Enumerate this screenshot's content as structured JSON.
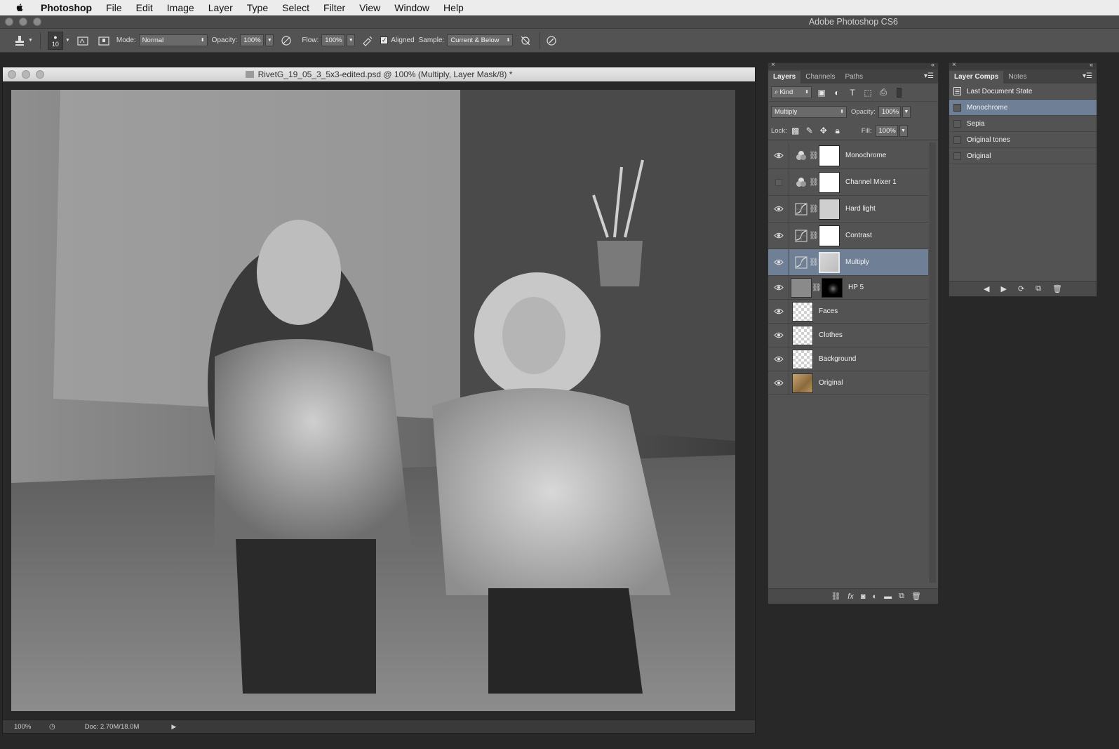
{
  "menubar": {
    "app_name": "Photoshop",
    "items": [
      "File",
      "Edit",
      "Image",
      "Layer",
      "Type",
      "Select",
      "Filter",
      "View",
      "Window",
      "Help"
    ]
  },
  "app_title": "Adobe Photoshop CS6",
  "options_bar": {
    "tool_icon": "clone-stamp-icon",
    "brush_size": "10",
    "mode_label": "Mode:",
    "mode_value": "Normal",
    "opacity_label": "Opacity:",
    "opacity_value": "100%",
    "flow_label": "Flow:",
    "flow_value": "100%",
    "aligned_label": "Aligned",
    "aligned_checked": true,
    "sample_label": "Sample:",
    "sample_value": "Current & Below"
  },
  "document": {
    "title": "RivetG_19_05_3_5x3-edited.psd @ 100% (Multiply, Layer Mask/8) *",
    "zoom": "100%",
    "doc_size": "Doc: 2.70M/18.0M"
  },
  "layers_panel": {
    "tabs": [
      "Layers",
      "Channels",
      "Paths"
    ],
    "active_tab": "Layers",
    "filter_kind": "Kind",
    "blend_mode": "Multiply",
    "opacity_label": "Opacity:",
    "opacity_value": "100%",
    "lock_label": "Lock:",
    "fill_label": "Fill:",
    "fill_value": "100%",
    "layers": [
      {
        "name": "Monochrome",
        "visible": true,
        "type": "channel-mixer",
        "selected": false
      },
      {
        "name": "Channel Mixer 1",
        "visible": false,
        "type": "channel-mixer",
        "selected": false
      },
      {
        "name": "Hard light",
        "visible": true,
        "type": "curves",
        "selected": false
      },
      {
        "name": "Contrast",
        "visible": true,
        "type": "curves",
        "selected": false
      },
      {
        "name": "Multiply",
        "visible": true,
        "type": "curves",
        "selected": true
      },
      {
        "name": "HP 5",
        "visible": true,
        "type": "fill",
        "selected": false
      },
      {
        "name": "Faces",
        "visible": true,
        "type": "pixel",
        "selected": false
      },
      {
        "name": "Clothes",
        "visible": true,
        "type": "pixel",
        "selected": false
      },
      {
        "name": "Background",
        "visible": true,
        "type": "pixel",
        "selected": false
      },
      {
        "name": "Original",
        "visible": true,
        "type": "pixel",
        "selected": false
      }
    ]
  },
  "comps_panel": {
    "tabs": [
      "Layer Comps",
      "Notes"
    ],
    "active_tab": "Layer Comps",
    "comps": [
      {
        "name": "Last Document State",
        "selected": false
      },
      {
        "name": "Monochrome",
        "selected": true
      },
      {
        "name": "Sepia",
        "selected": false
      },
      {
        "name": "Original tones",
        "selected": false
      },
      {
        "name": "Original",
        "selected": false
      }
    ]
  },
  "colors": {
    "selection": "#6f7f96",
    "panel": "#535353",
    "workspace": "#282828"
  }
}
